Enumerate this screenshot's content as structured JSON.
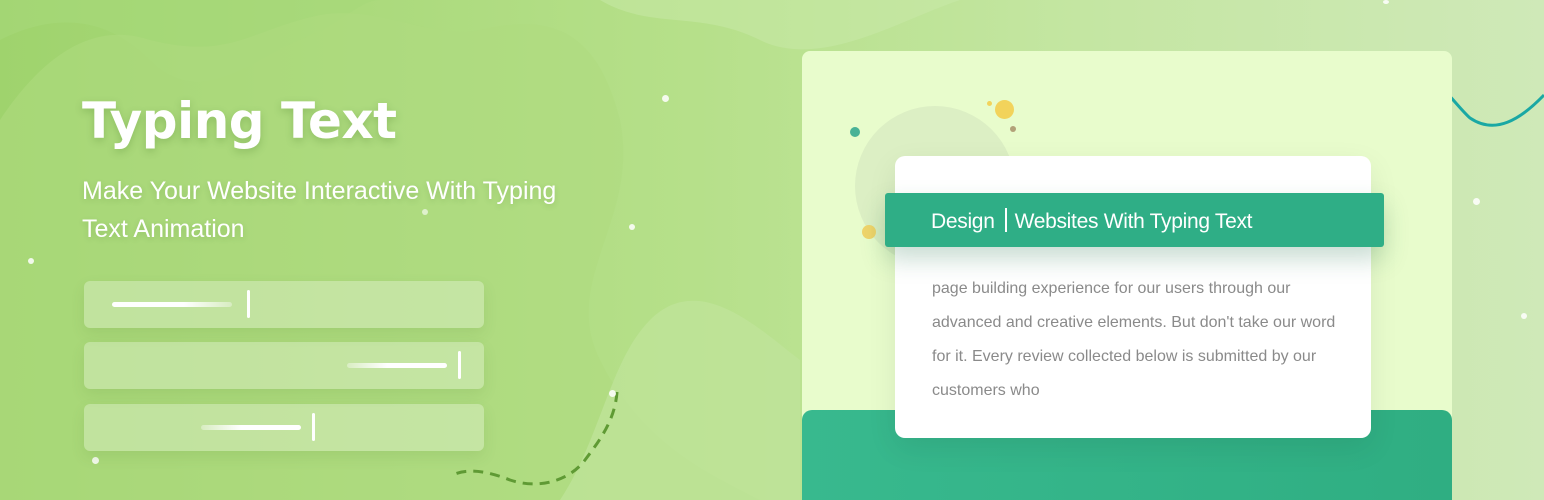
{
  "hero": {
    "title": "Typing Text",
    "subtitle": "Make Your Website Interactive With Typing Text Animation"
  },
  "preview_card": {
    "banner_word": "Design",
    "banner_phrase": "Websites With Typing Text",
    "body_text": "page building experience for our users through our advanced and creative elements. But don't take our word for it. Every review collected below is submitted by our customers who"
  },
  "colors": {
    "background": "#a8d879",
    "card_background": "#e8fccc",
    "accent_green": "#2fae86",
    "accent_teal": "#1aa8a4",
    "dot_yellow": "#f2d35b",
    "dot_teal": "#49b296"
  }
}
